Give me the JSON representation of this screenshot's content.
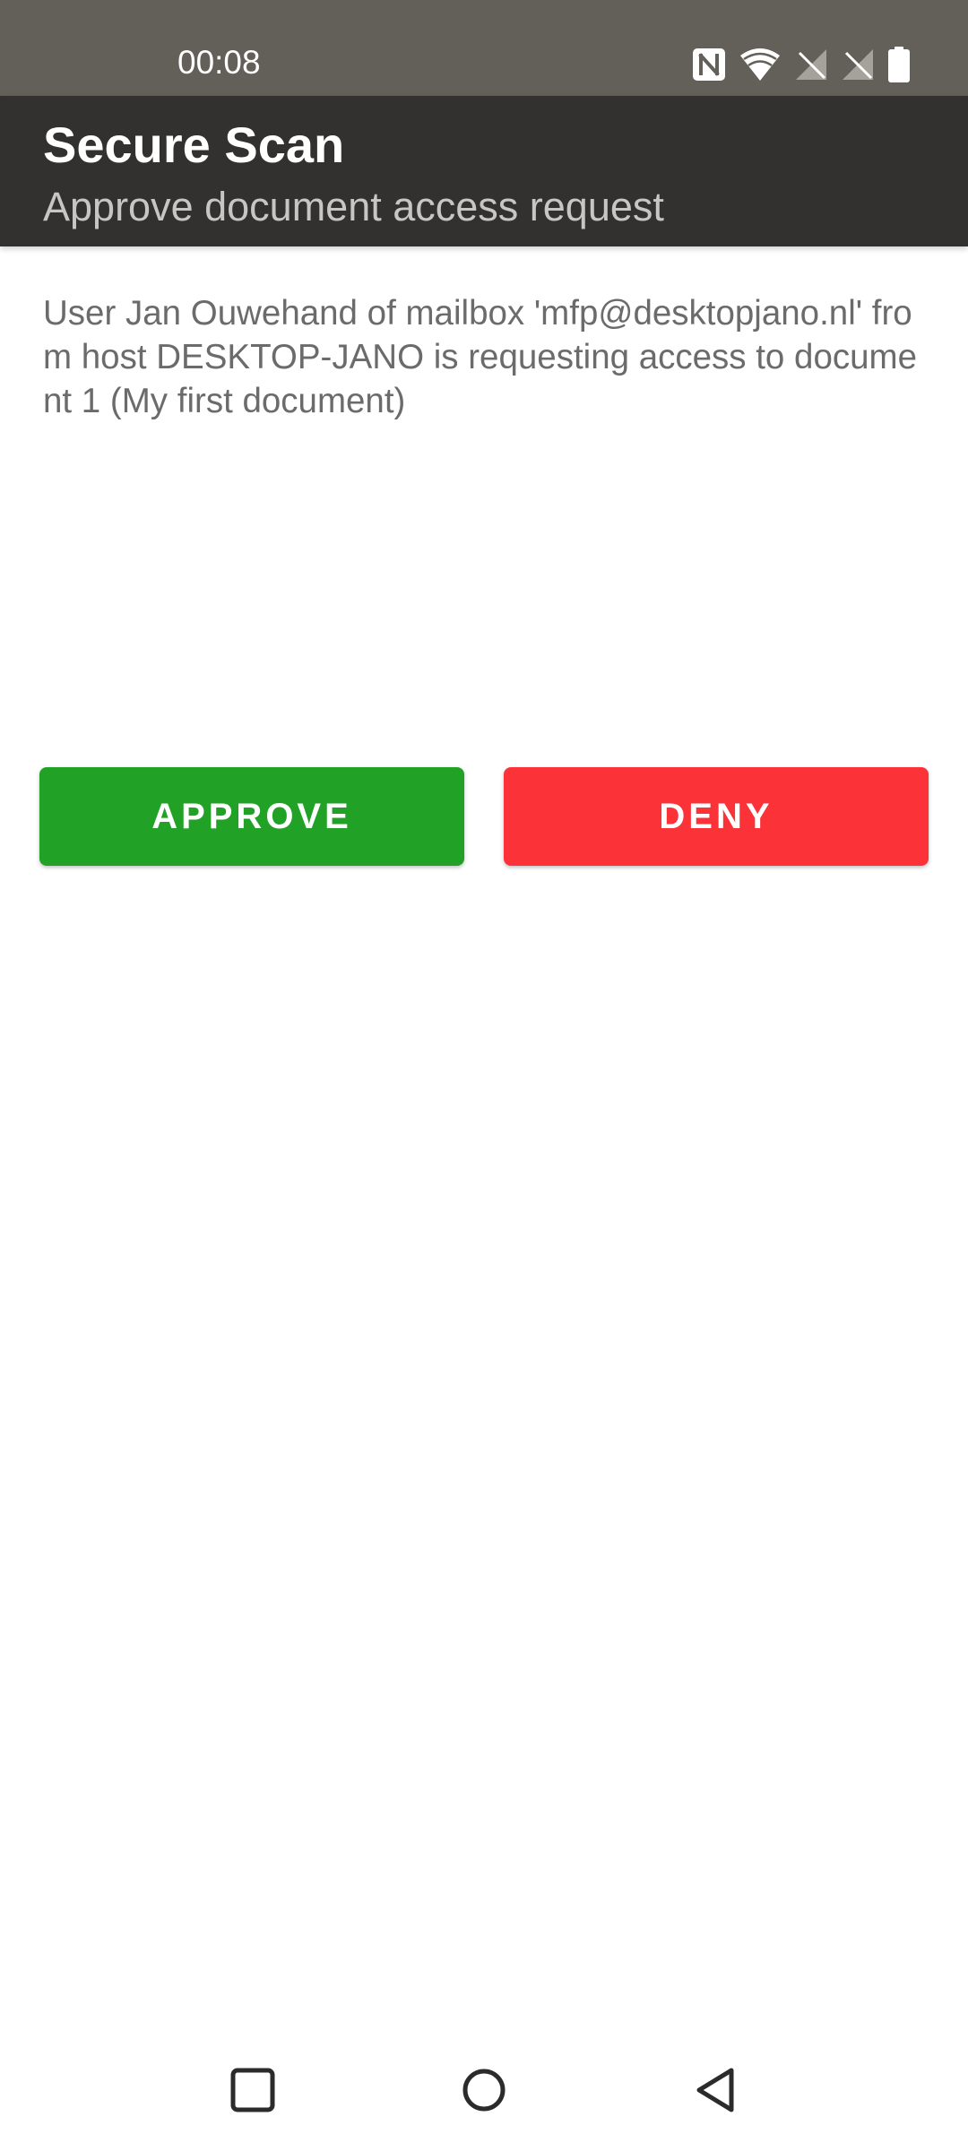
{
  "status_bar": {
    "time": "00:08",
    "icons": [
      "nfc-icon",
      "wifi-icon",
      "signal-no-sim-icon",
      "signal-no-sim-icon",
      "battery-icon"
    ]
  },
  "app_bar": {
    "title": "Secure Scan",
    "subtitle": "Approve document access request"
  },
  "message": {
    "text": "User Jan Ouwehand of mailbox 'mfp@desktopjano.nl' from host DESKTOP-JANO is requesting access to document 1 (My first document)"
  },
  "actions": {
    "approve_label": "APPROVE",
    "deny_label": "DENY"
  },
  "colors": {
    "status_bar_bg": "#636059",
    "app_bar_bg": "#32312f",
    "approve": "#21a227",
    "deny": "#fb3339",
    "nav_icon": "#2b2b2b"
  },
  "nav_bar": {
    "icons": [
      "recents-icon",
      "home-icon",
      "back-icon"
    ]
  }
}
